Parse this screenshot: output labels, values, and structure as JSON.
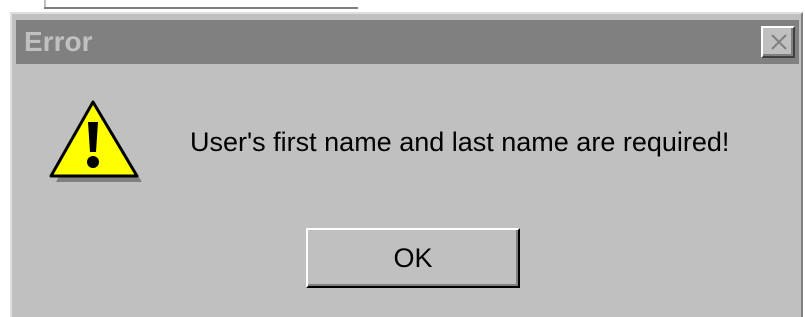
{
  "dialog": {
    "title": "Error",
    "message": "User's first name and last name are required!",
    "ok_label": "OK"
  },
  "icons": {
    "warning": "warning-icon",
    "close": "close-icon"
  },
  "colors": {
    "dialog_bg": "#c0c0c0",
    "titlebar_inactive": "#808080",
    "warning_yellow": "#ffff00"
  }
}
